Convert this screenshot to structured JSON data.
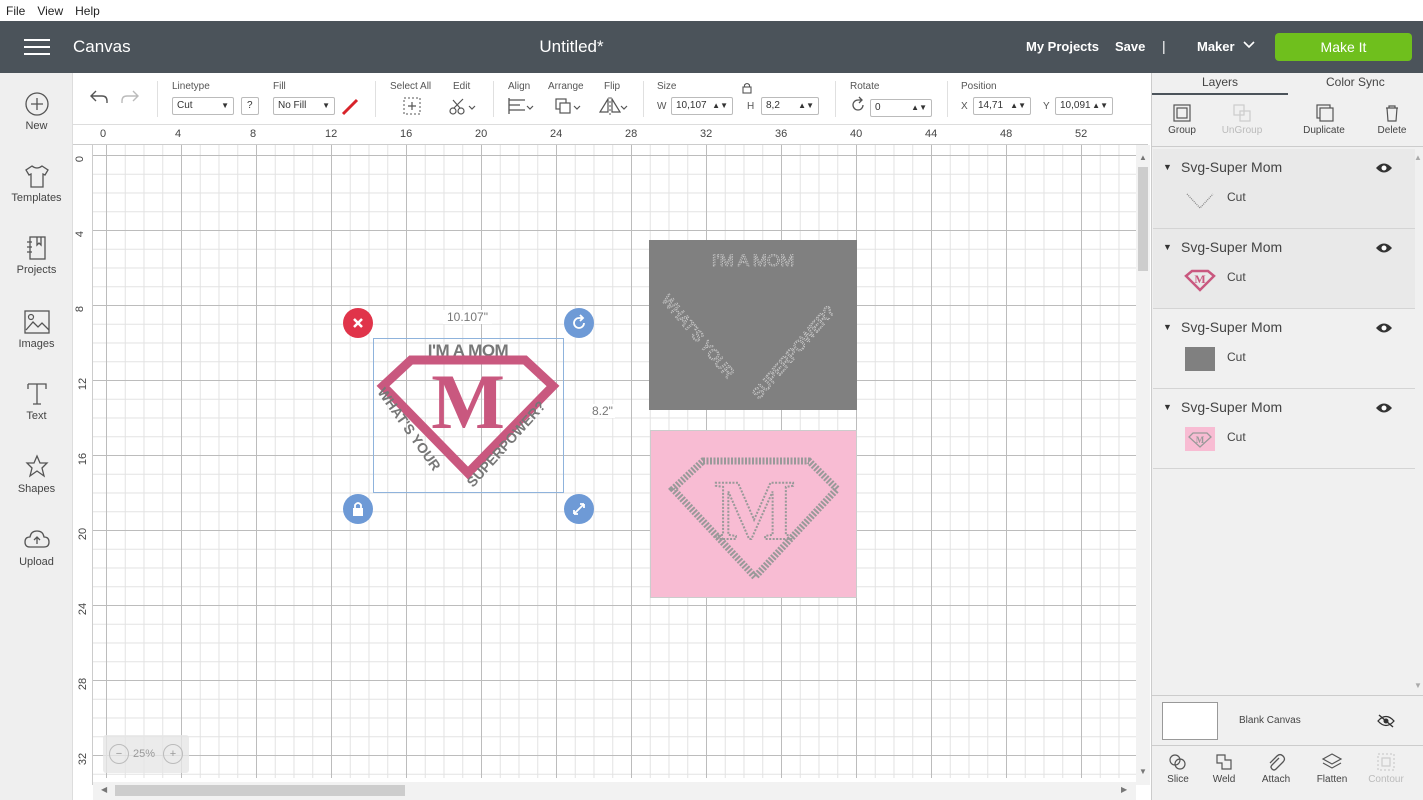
{
  "menu": {
    "file": "File",
    "view": "View",
    "help": "Help"
  },
  "header": {
    "brand": "Canvas",
    "doc_title": "Untitled*",
    "my_projects": "My Projects",
    "save": "Save",
    "separator": "|",
    "machine": "Maker",
    "make_it": "Make It",
    "accent": "#6fbf1d",
    "bg": "#4b535a"
  },
  "sidebar": {
    "new": "New",
    "templates": "Templates",
    "projects": "Projects",
    "images": "Images",
    "text": "Text",
    "shapes": "Shapes",
    "upload": "Upload"
  },
  "toolbar": {
    "linetype_label": "Linetype",
    "linetype_value": "Cut",
    "fill_label": "Fill",
    "fill_value": "No Fill",
    "help_q": "?",
    "select_all": "Select All",
    "edit": "Edit",
    "align": "Align",
    "arrange": "Arrange",
    "flip": "Flip",
    "size": "Size",
    "w_label": "W",
    "w_value": "10,107",
    "h_label": "H",
    "h_value": "8,2",
    "rotate": "Rotate",
    "rotate_value": "0",
    "position": "Position",
    "x_label": "X",
    "x_value": "14,71",
    "y_label": "Y",
    "y_value": "10,091"
  },
  "ruler": {
    "top": [
      "0",
      "4",
      "8",
      "12",
      "16",
      "20",
      "24",
      "28",
      "32",
      "36",
      "40",
      "44",
      "48",
      "52"
    ],
    "left": [
      "0",
      "4",
      "8",
      "12",
      "16",
      "20",
      "24",
      "28",
      "32"
    ]
  },
  "canvas": {
    "selection_width": "10.107\"",
    "selection_height": "8.2\"",
    "design_top_text": "I'M A MOM",
    "design_letter": "M",
    "design_bottom_text": "WHAT'S YOUR SUPERPOWER?",
    "grey_card_color": "#808080",
    "pink_card_color": "#f8bcd3",
    "design_pink": "#c9587f"
  },
  "zoom": {
    "level": "25%",
    "minus": "−",
    "plus": "+"
  },
  "panel": {
    "tab_layers": "Layers",
    "tab_color_sync": "Color Sync",
    "group": "Group",
    "ungroup": "UnGroup",
    "duplicate": "Duplicate",
    "delete": "Delete",
    "layers": [
      {
        "name": "Svg-Super Mom",
        "op": "Cut"
      },
      {
        "name": "Svg-Super Mom",
        "op": "Cut"
      },
      {
        "name": "Svg-Super Mom",
        "op": "Cut"
      },
      {
        "name": "Svg-Super Mom",
        "op": "Cut"
      }
    ],
    "blank_canvas": "Blank Canvas",
    "slice": "Slice",
    "weld": "Weld",
    "attach": "Attach",
    "flatten": "Flatten",
    "contour": "Contour"
  }
}
